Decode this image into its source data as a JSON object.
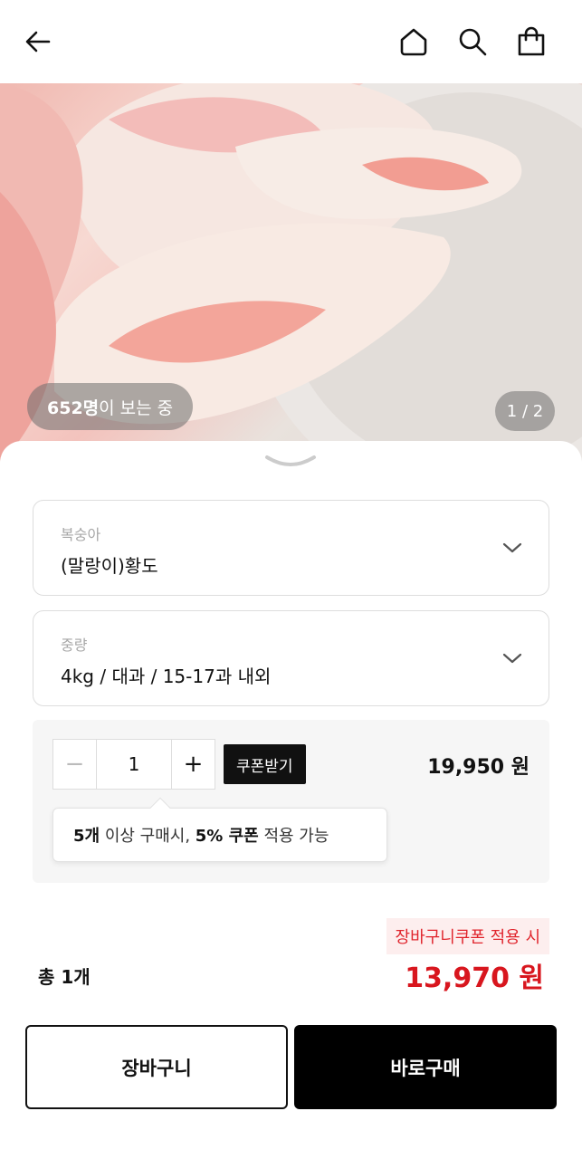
{
  "header": {
    "back_icon": "arrow-left-icon",
    "home_icon": "home-icon",
    "search_icon": "search-icon",
    "cart_icon": "shopping-bag-icon"
  },
  "hero": {
    "viewer_count": "652명",
    "viewer_suffix": "이 보는 중",
    "page_indicator": "1 / 2"
  },
  "options": [
    {
      "label": "복숭아",
      "value": "(말랑이)황도"
    },
    {
      "label": "중량",
      "value": "4kg / 대과 / 15-17과 내외"
    }
  ],
  "quantity": {
    "minus": "−",
    "value": "1",
    "plus": "+",
    "coupon_button": "쿠폰받기",
    "unit_price": "19,950 원",
    "tooltip": {
      "count": "5개",
      "text1": " 이상 구매시, ",
      "discount": "5% 쿠폰",
      "text2": " 적용 가능"
    }
  },
  "summary": {
    "coupon_tag": "장바구니쿠폰 적용 시",
    "total_count": "총 1개",
    "total_price": "13,970 원"
  },
  "actions": {
    "cart_label": "장바구니",
    "buy_label": "바로구매"
  },
  "colors": {
    "accent_red": "#d8161e",
    "coupon_bg": "#fdeeee",
    "primary": "#000000"
  }
}
